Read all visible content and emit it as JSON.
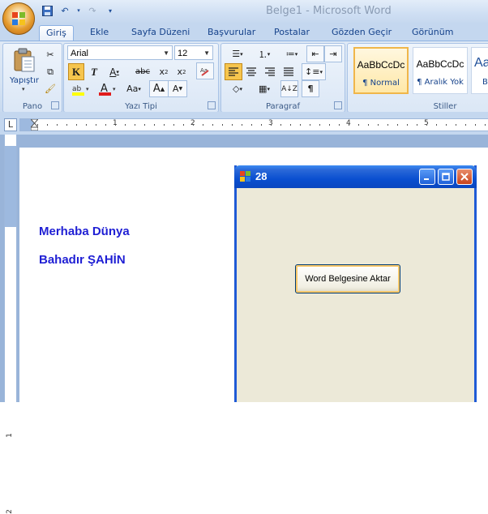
{
  "window": {
    "title": "Belge1 - Microsoft Word"
  },
  "ribbon": {
    "tabs": [
      "Giriş",
      "Ekle",
      "Sayfa Düzeni",
      "Başvurular",
      "Postalar",
      "Gözden Geçir",
      "Görünüm"
    ],
    "active_tab": "Giriş",
    "groups": {
      "pano": "Pano",
      "yazi_tipi": "Yazı Tipi",
      "paragraf": "Paragraf",
      "stiller": "Stiller"
    },
    "paste_label": "Yapıştır",
    "font_name": "Arial",
    "font_size": "12",
    "styles": [
      {
        "sample": "AaBbCcDc",
        "name": "¶ Normal"
      },
      {
        "sample": "AaBbCcDc",
        "name": "¶ Aralık Yok"
      },
      {
        "sample": "AaB",
        "name": "B"
      }
    ]
  },
  "ruler": {
    "numbers": [
      "1",
      "2",
      "3",
      "4",
      "5"
    ],
    "vertical_numbers": [
      "1",
      "2"
    ]
  },
  "document": {
    "lines": [
      "Merhaba Dünya",
      "Bahadır ŞAHİN"
    ]
  },
  "dialog": {
    "title": "28",
    "button_label": "Word Belgesine Aktar"
  },
  "colors": {
    "ribbon_bg": "#d5e3f3",
    "doc_text": "#1f1fd4",
    "xp_title": "#0a4fd0",
    "dialog_bg": "#ece9d8"
  }
}
